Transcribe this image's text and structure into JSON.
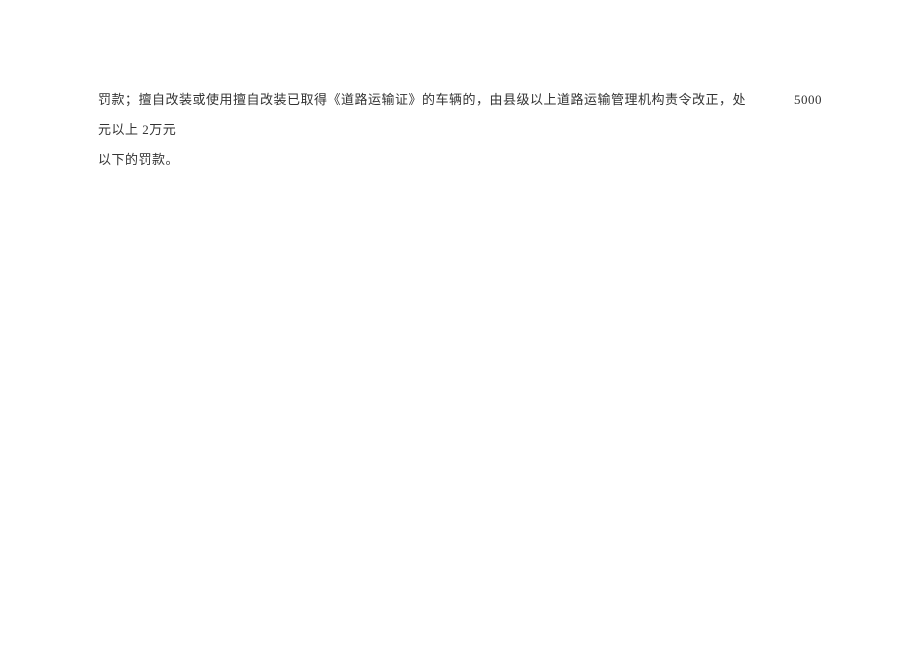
{
  "document": {
    "line1_part1": "罚款；擅自改装或使用擅自改装已取得《道路运输证》的车辆的，由县级以上道路运输管理机构责令改正，处",
    "line1_part2": "5000元以上 2万元",
    "line2": "以下的罚款。"
  }
}
